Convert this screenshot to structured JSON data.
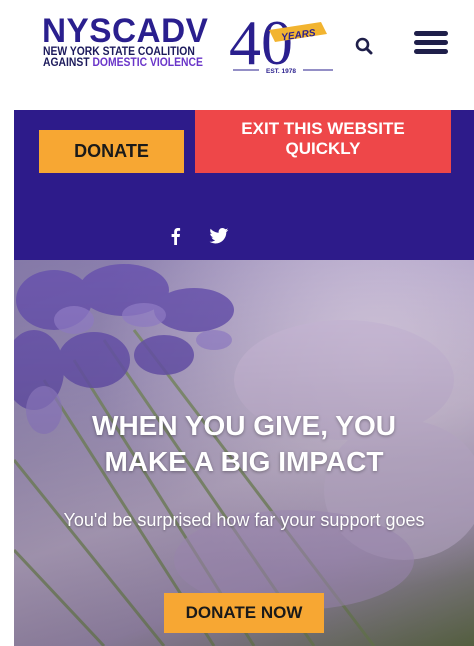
{
  "header": {
    "logo_word": "NYSCADV",
    "logo_line1": "NEW YORK STATE COALITION",
    "logo_line2_part1": "AGAINST ",
    "logo_line2_part2": "DOMESTIC VIOLENCE",
    "anniversary_number": "40",
    "anniversary_word": "YEARS",
    "established": "EST. 1978",
    "search_icon": "search-icon",
    "menu_icon": "hamburger-menu-icon"
  },
  "actions": {
    "donate_label": "DONATE",
    "exit_label": "EXIT THIS WEBSITE QUICKLY"
  },
  "social": {
    "icons": [
      "facebook-icon",
      "twitter-icon"
    ]
  },
  "hero": {
    "title_line1": "WHEN YOU GIVE, YOU",
    "title_line2": "MAKE A BIG IMPACT",
    "subtitle": "You'd be surprised how far your support goes",
    "cta_label": "DONATE NOW"
  },
  "colors": {
    "brand_purple": "#2d1b8a",
    "donate_orange": "#f7a733",
    "exit_red": "#ee4749",
    "logo_navy": "#2a1f8e",
    "anniversary_gold": "#f2b430"
  }
}
